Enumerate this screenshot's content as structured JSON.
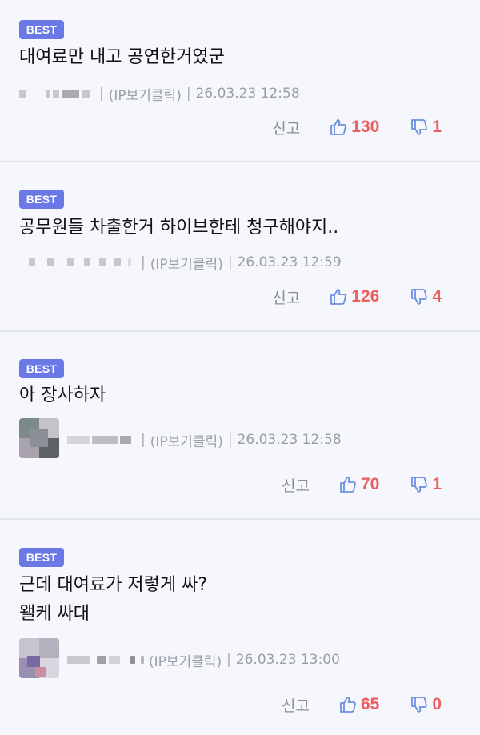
{
  "comments": [
    {
      "badge": "BEST",
      "text": "대여료만 내고 공연한거였군",
      "ip_label": "(IP보기클릭)",
      "date": "26.03.23 12:58",
      "report_label": "신고",
      "likes": "130",
      "dislikes": "1",
      "has_avatar": false
    },
    {
      "badge": "BEST",
      "text": "공무원들 차출한거 하이브한테 청구해야지..",
      "ip_label": "(IP보기클릭)",
      "date": "26.03.23 12:59",
      "report_label": "신고",
      "likes": "126",
      "dislikes": "4",
      "has_avatar": false
    },
    {
      "badge": "BEST",
      "text": "아 장사하자",
      "ip_label": "(IP보기클릭)",
      "date": "26.03.23 12:58",
      "report_label": "신고",
      "likes": "70",
      "dislikes": "1",
      "has_avatar": true
    },
    {
      "badge": "BEST",
      "text": "근데 대여료가 저렇게 싸?\n왤케 싸대",
      "ip_label": "(IP보기클릭)",
      "date": "26.03.23 13:00",
      "report_label": "신고",
      "likes": "65",
      "dislikes": "0",
      "has_avatar": true
    }
  ],
  "colors": {
    "badge": "#6a79e6",
    "like_icon": "#6b8fe0",
    "count": "#ea5f5f",
    "background": "#f5f7fc"
  }
}
